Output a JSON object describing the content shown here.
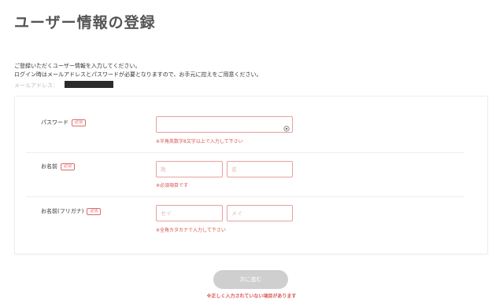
{
  "page": {
    "title": "ユーザー情報の登録"
  },
  "intro": {
    "line1": "ご登録いただくユーザー情報を入力してください。",
    "line2": "ログイン時はメールアドレスとパスワードが必要となりますので、お手元に控えをご用意ください。",
    "email_label": "メールアドレス：",
    "email_value_redacted": true
  },
  "form": {
    "required_badge": "必須",
    "password": {
      "label": "パスワード",
      "value": "",
      "icon": "eye-icon",
      "error": "※半角英数字8文字以上で入力して下さい"
    },
    "name": {
      "label": "お名前",
      "last_placeholder": "姓",
      "first_placeholder": "名",
      "last_value": "",
      "first_value": "",
      "error": "※必須項目です"
    },
    "kana": {
      "label": "お名前(フリガナ)",
      "last_placeholder": "セイ",
      "first_placeholder": "メイ",
      "last_value": "",
      "first_value": "",
      "error": "※全角カタカナで入力して下さい"
    }
  },
  "footer": {
    "next_label": "次に進む",
    "error": "※正しく入力されていない項目があります"
  },
  "colors": {
    "error": "#d9534f",
    "field_border": "#e8a0a0",
    "button_disabled": "#cfcfcf"
  }
}
